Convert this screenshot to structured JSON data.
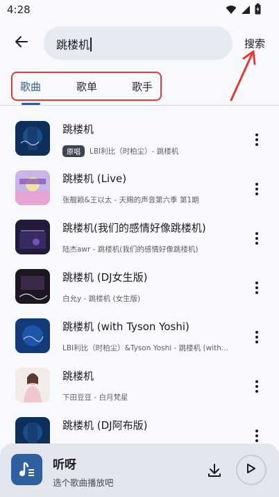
{
  "status_bar": {
    "time": "4:28"
  },
  "search": {
    "query": "跳楼机",
    "submit_label": "搜索"
  },
  "tabs": [
    {
      "label": "歌曲",
      "active": true
    },
    {
      "label": "歌单",
      "active": false
    },
    {
      "label": "歌手",
      "active": false
    }
  ],
  "songs": [
    {
      "title": "跳楼机",
      "badge": "原唱",
      "subtitle": "LBI利比（时柏尘）- 跳楼机"
    },
    {
      "title": "跳楼机 (Live)",
      "badge": "",
      "subtitle": "张靓颖&王以太 - 天赐的声音第六季 第1期"
    },
    {
      "title": "跳楼机(我们的感情好像跳楼机)",
      "badge": "",
      "subtitle": "陆杰awr - 跳楼机(我们的感情好像跳楼机)"
    },
    {
      "title": "跳楼机 (DJ女生版)",
      "badge": "",
      "subtitle": "白允y - 跳楼机 (女生版)"
    },
    {
      "title": "跳楼机 (with Tyson Yoshi)",
      "badge": "",
      "subtitle": "LBI利比（时柏尘）&Tyson Yoshi - 跳楼机 (with..."
    },
    {
      "title": "跳楼机",
      "badge": "",
      "subtitle": "下田豆豆 - 白月梵星"
    },
    {
      "title": "跳楼机 (DJ阿布版)",
      "badge": "",
      "subtitle": ""
    }
  ],
  "player": {
    "title": "听呀",
    "subtitle": "选个歌曲播放吧"
  },
  "colors": {
    "accent": "#3b5b8e",
    "annotation_red": "#e53935",
    "player_icon_bg": "#2f5f9e"
  },
  "icons": {
    "back": "arrow-left-icon",
    "more": "more-vert-icon",
    "download": "download-icon",
    "play": "play-icon",
    "wifi": "wifi-icon",
    "signal": "signal-icon",
    "battery": "battery-icon"
  }
}
